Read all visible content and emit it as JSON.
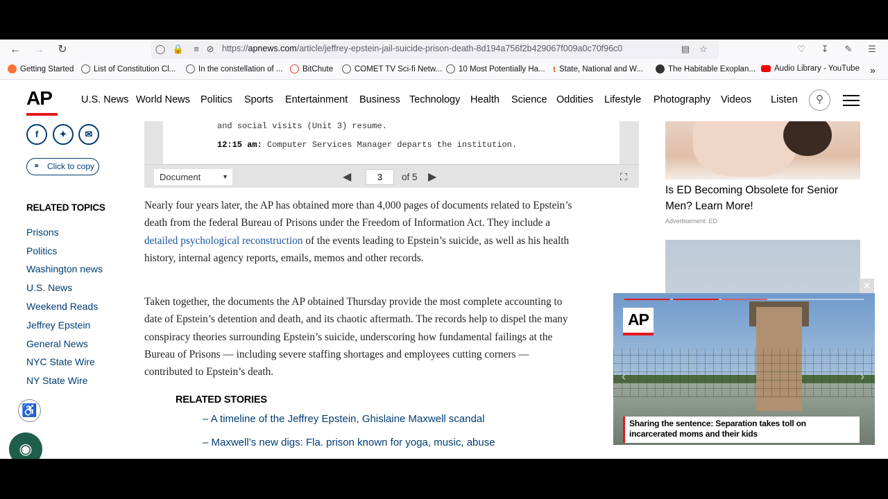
{
  "browser": {
    "url_prefix": "https://",
    "url_host": "apnews.com",
    "url_path": "/article/jeffrey-epstein-jail-suicide-prison-death-8d194a756f2b429067f009a0c70f96c0",
    "bookmarks": [
      "Getting Started",
      "List of Constitution Cl...",
      "In the constellation of ...",
      "BitChute",
      "COMET TV Sci-fi Netw...",
      "10 Most Potentially Ha...",
      "State, National and W...",
      "The Habitable Exoplan...",
      "Audio Library - YouTube"
    ]
  },
  "header": {
    "logo": "AP",
    "nav": [
      "U.S. News",
      "World News",
      "Politics",
      "Sports",
      "Entertainment",
      "Business",
      "Technology",
      "Health",
      "Science",
      "Oddities",
      "Lifestyle",
      "Photography",
      "Videos",
      "Listen"
    ]
  },
  "share": {
    "copy_label": "Click to copy"
  },
  "related_topics": {
    "title": "RELATED TOPICS",
    "items": [
      "Prisons",
      "Politics",
      "Washington news",
      "U.S. News",
      "Weekend Reads",
      "Jeffrey Epstein",
      "General News",
      "NYC State Wire",
      "NY State Wire"
    ]
  },
  "document": {
    "line1": "and social visits (Unit 3) resume.",
    "line2_time": "12:15 am:",
    "line2_text": "Computer Services Manager departs the institution.",
    "select_value": "Document",
    "page_value": "3",
    "of_label": "of 5"
  },
  "article": {
    "p1_before": "Nearly four years later, the AP has obtained more than 4,000 pages of documents related to Epstein’s death from the federal Bureau of Prisons under the Freedom of Information Act. They include a ",
    "p1_link": "detailed psychological reconstruction",
    "p1_after": " of the events leading to Epstein’s suicide, as well as his health history, internal agency reports, emails, memos and other records.",
    "p2": "Taken together, the documents the AP obtained Thursday provide the most complete accounting to date of Epstein’s detention and death, and its chaotic aftermath. The records help to dispel the many conspiracy theories surrounding Epstein’s suicide, underscoring how fundamental failings at the Bureau of Prisons — including severe staffing shortages and employees cutting corners — contributed to Epstein’s death."
  },
  "related_stories": {
    "title": "RELATED STORIES",
    "items": [
      "– A timeline of the Jeffrey Epstein, Ghislaine Maxwell scandal",
      "– Maxwell’s new digs: Fla. prison known for yoga, music, abuse"
    ]
  },
  "ad": {
    "title": "Is ED Becoming Obsolete for Senior Men? Learn More!",
    "label": "Advertisement: ED"
  },
  "video": {
    "logo": "AP",
    "caption": "Sharing the sentence: Separation takes toll on incarcerated moms and their kids"
  },
  "colors": {
    "ap_red": "#e6171c",
    "link_blue": "#003c73",
    "inline_link": "#1a56a0"
  }
}
